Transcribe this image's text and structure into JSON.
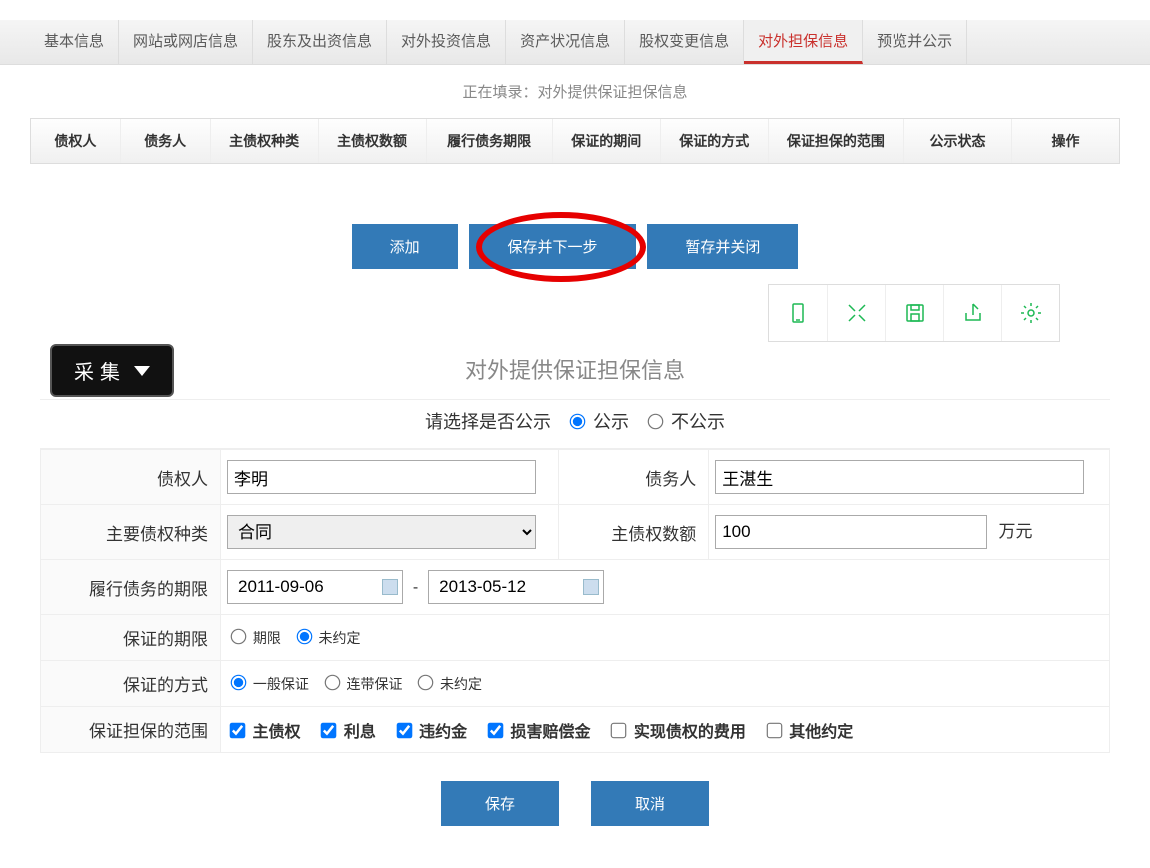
{
  "nav": {
    "tabs": [
      "基本信息",
      "网站或网店信息",
      "股东及出资信息",
      "对外投资信息",
      "资产状况信息",
      "股权变更信息",
      "对外担保信息",
      "预览并公示"
    ],
    "activeIndex": 6
  },
  "subtitle": "正在填录：对外提供保证担保信息",
  "columns": [
    "债权人",
    "债务人",
    "主债权种类",
    "主债权数额",
    "履行债务期限",
    "保证的期间",
    "保证的方式",
    "保证担保的范围",
    "公示状态",
    "操作"
  ],
  "actions": {
    "add": "添加",
    "saveNext": "保存并下一步",
    "tempClose": "暂存并关闭"
  },
  "collect": "采集",
  "form": {
    "title": "对外提供保证担保信息",
    "publicLabel": "请选择是否公示",
    "publicOpts": {
      "yes": "公示",
      "no": "不公示"
    },
    "labels": {
      "creditor": "债权人",
      "debtor": "债务人",
      "mainType": "主要债权种类",
      "mainAmount": "主债权数额",
      "unit": "万元",
      "performPeriod": "履行债务的期限",
      "guaranteePeriod": "保证的期限",
      "guaranteeMethod": "保证的方式",
      "guaranteeScope": "保证担保的范围"
    },
    "values": {
      "creditor": "李明",
      "debtor": "王湛生",
      "mainType": "合同",
      "mainAmount": "100",
      "dateFrom": "2011-09-06",
      "dateTo": "2013-05-12"
    },
    "periodOpts": {
      "period": "期限",
      "undecided": "未约定"
    },
    "methodOpts": {
      "general": "一般保证",
      "joint": "连带保证",
      "undecided": "未约定"
    },
    "scopeOpts": [
      "主债权",
      "利息",
      "违约金",
      "损害赔偿金",
      "实现债权的费用",
      "其他约定"
    ],
    "save": "保存",
    "cancel": "取消"
  }
}
